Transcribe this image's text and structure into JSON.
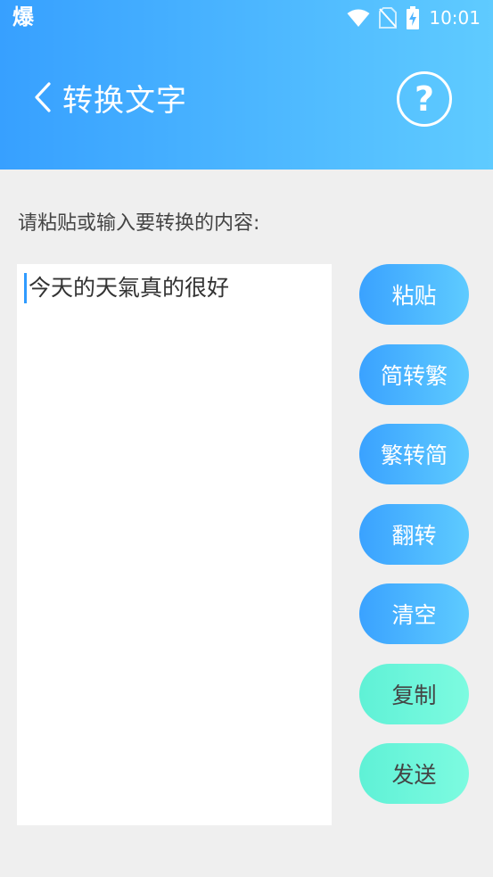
{
  "status_bar": {
    "app_badge": "爆",
    "time": "10:01",
    "icons": [
      "wifi-icon",
      "no-sim-icon",
      "battery-charging-icon"
    ]
  },
  "header": {
    "title": "转换文字",
    "back_icon": "chevron-left-icon",
    "help_icon": "question-circle-icon",
    "help_glyph": "?"
  },
  "main": {
    "prompt": "请粘贴或输入要转换的内容:",
    "editor_text": "今天的天氣真的很好"
  },
  "buttons": {
    "paste": "粘贴",
    "to_traditional": "简转繁",
    "to_simplified": "繁转简",
    "reverse": "翻转",
    "clear": "清空",
    "copy": "复制",
    "send": "发送"
  },
  "colors": {
    "header_gradient": [
      "#37a0ff",
      "#5fcbff"
    ],
    "blue_button": [
      "#3aa2ff",
      "#5ecbff"
    ],
    "mint_button": [
      "#5ff1d6",
      "#7dfbe0"
    ],
    "caret": "#2f9bff"
  }
}
